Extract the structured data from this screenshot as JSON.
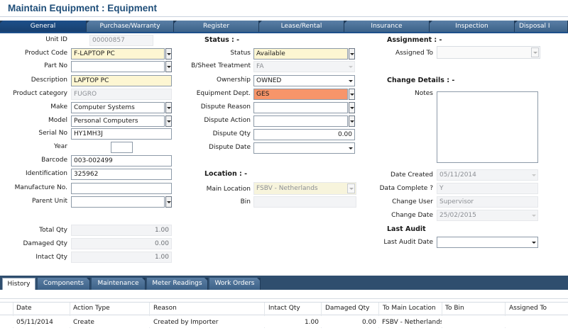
{
  "page_title": "Maintain Equipment : Equipment",
  "tabs": [
    "General",
    "Purchase/Warranty",
    "Register",
    "Lease/Rental",
    "Insurance",
    "Inspection",
    "Disposal I"
  ],
  "general": {
    "unit_id_label": "Unit ID",
    "unit_id": "00000857",
    "product_code_label": "Product Code",
    "product_code": "F-LAPTOP PC",
    "part_no_label": "Part No",
    "part_no": "",
    "description_label": "Description",
    "description": "LAPTOP PC",
    "product_category_label": "Product category",
    "product_category": "FUGRO",
    "make_label": "Make",
    "make": "Computer Systems",
    "model_label": "Model",
    "model": "Personal Computers",
    "serial_no_label": "Serial No",
    "serial_no": "HY1MH3J",
    "year_label": "Year",
    "year": "",
    "barcode_label": "Barcode",
    "barcode": "003-002499",
    "identification_label": "Identification",
    "identification": "325962",
    "manufacture_no_label": "Manufacture No.",
    "manufacture_no": "",
    "parent_unit_label": "Parent Unit",
    "parent_unit": "",
    "total_qty_label": "Total Qty",
    "total_qty": "1.00",
    "damaged_qty_label": "Damaged Qty",
    "damaged_qty": "0.00",
    "intact_qty_label": "Intact Qty",
    "intact_qty": "1.00"
  },
  "status": {
    "header": "Status  : -",
    "status_label": "Status",
    "status": "Available",
    "bsheet_label": "B/Sheet Treatment",
    "bsheet": "FA",
    "ownership_label": "Ownership",
    "ownership": "OWNED",
    "equip_dept_label": "Equipment Dept.",
    "equip_dept": "GES",
    "dispute_reason_label": "Dispute Reason",
    "dispute_reason": "",
    "dispute_action_label": "Dispute Action",
    "dispute_action": "",
    "dispute_qty_label": "Dispute Qty",
    "dispute_qty": "0.00",
    "dispute_date_label": "Dispute Date",
    "dispute_date": ""
  },
  "location": {
    "header": "Location : -",
    "main_location_label": "Main Location",
    "main_location": "FSBV - Netherlands",
    "bin_label": "Bin",
    "bin": ""
  },
  "assignment": {
    "header": "Assignment : -",
    "assigned_to_label": "Assigned To",
    "assigned_to": ""
  },
  "change_details": {
    "header": "Change Details : -",
    "notes_label": "Notes",
    "notes": "",
    "date_created_label": "Date Created",
    "date_created": "05/11/2014",
    "data_complete_label": "Data Complete ?",
    "data_complete": "Y",
    "change_user_label": "Change User",
    "change_user": "Supervisor",
    "change_date_label": "Change Date",
    "change_date": "25/02/2015"
  },
  "last_audit": {
    "header": "Last Audit",
    "last_audit_date_label": "Last Audit Date",
    "last_audit_date": ""
  },
  "bottom_tabs": [
    "History",
    "Components",
    "Maintenance",
    "Meter Readings",
    "Work Orders"
  ],
  "history": {
    "columns": [
      "Date",
      "Action Type",
      "Reason",
      "Intact Qty",
      "Damaged Qty",
      "To Main Location",
      "To Bin",
      "Assigned To"
    ],
    "rows": [
      [
        "05/11/2014",
        "Create",
        "Created by Importer",
        "1.00",
        "0.00",
        "FSBV - Netherlands",
        "",
        ""
      ]
    ]
  },
  "colors": {
    "title": "#1f4e79",
    "tab_active": "#1d4f8a",
    "tab": "#4a6f96",
    "highlight_yellow": "#fdf6d2",
    "highlight_orange": "#f7956a"
  }
}
